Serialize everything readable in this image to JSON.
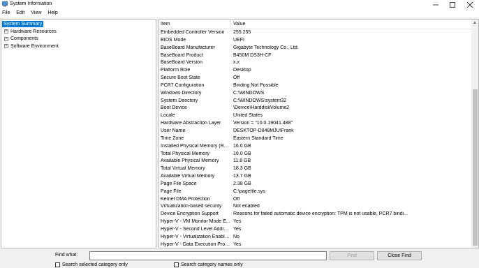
{
  "window": {
    "title": "System Information"
  },
  "menu": [
    "File",
    "Edit",
    "View",
    "Help"
  ],
  "tree": {
    "selected": "System Summary",
    "items": [
      {
        "label": "Hardware Resources",
        "expander": "+"
      },
      {
        "label": "Components",
        "expander": "+"
      },
      {
        "label": "Software Environment",
        "expander": "+"
      }
    ]
  },
  "table": {
    "headers": {
      "item": "Item",
      "value": "Value"
    },
    "rows": [
      {
        "item": "Embedded Controller Version",
        "value": "255.255"
      },
      {
        "item": "BIOS Mode",
        "value": "UEFI"
      },
      {
        "item": "BaseBoard Manufacturer",
        "value": "Gigabyte Technology Co., Ltd."
      },
      {
        "item": "BaseBoard Product",
        "value": "B450M DS3H-CF"
      },
      {
        "item": "BaseBoard Version",
        "value": "x.x"
      },
      {
        "item": "Platform Role",
        "value": "Desktop"
      },
      {
        "item": "Secure Boot State",
        "value": "Off"
      },
      {
        "item": "PCR7 Configuration",
        "value": "Binding Not Possible"
      },
      {
        "item": "Windows Directory",
        "value": "C:\\WINDOWS"
      },
      {
        "item": "System Directory",
        "value": "C:\\WINDOWS\\system32"
      },
      {
        "item": "Boot Device",
        "value": "\\Device\\HarddiskVolume2"
      },
      {
        "item": "Locale",
        "value": "United States"
      },
      {
        "item": "Hardware Abstraction Layer",
        "value": "Version = \"10.0.19041.488\""
      },
      {
        "item": "User Name",
        "value": "DESKTOP-D848MJU\\Frank"
      },
      {
        "item": "Time Zone",
        "value": "Eastern Standard Time"
      },
      {
        "item": "Installed Physical Memory (RAM)",
        "value": "16.0 GB"
      },
      {
        "item": "Total Physical Memory",
        "value": "16.0 GB"
      },
      {
        "item": "Available Physical Memory",
        "value": "11.8 GB"
      },
      {
        "item": "Total Virtual Memory",
        "value": "18.3 GB"
      },
      {
        "item": "Available Virtual Memory",
        "value": "13.7 GB"
      },
      {
        "item": "Page File Space",
        "value": "2.38 GB"
      },
      {
        "item": "Page File",
        "value": "C:\\pagefile.sys"
      },
      {
        "item": "Kernel DMA Protection",
        "value": "Off"
      },
      {
        "item": "Virtualization-based security",
        "value": "Not enabled"
      },
      {
        "item": "Device Encryption Support",
        "value": "Reasons for failed automatic device encryption: TPM is not usable, PCR7 bindi..."
      },
      {
        "item": "Hyper-V - VM Monitor Mode E...",
        "value": "Yes"
      },
      {
        "item": "Hyper-V - Second Level Addres...",
        "value": "Yes"
      },
      {
        "item": "Hyper-V - Virtualization Enable...",
        "value": "No"
      },
      {
        "item": "Hyper-V - Data Execution Prote...",
        "value": "Yes"
      }
    ]
  },
  "find": {
    "label": "Find what:",
    "value": "",
    "find_button": "Find",
    "close_button": "Close Find",
    "checkbox_selected": "Search selected category only",
    "checkbox_names": "Search category names only"
  },
  "colors": {
    "selection": "#0078d7",
    "disabled_text": "#9a9a9a"
  }
}
